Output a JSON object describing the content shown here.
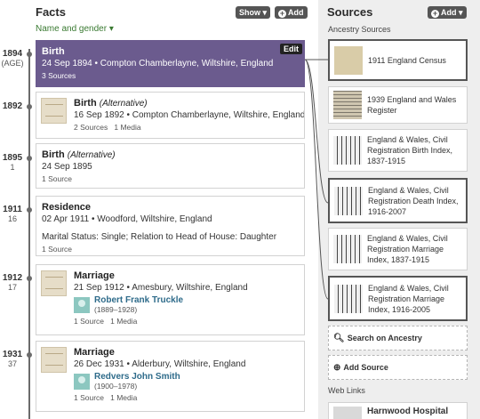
{
  "facts": {
    "title": "Facts",
    "show_label": "Show",
    "add_label": "Add",
    "filter_label": "Name and gender"
  },
  "timeline": [
    {
      "year": "1894",
      "age": "(AGE)"
    },
    {
      "year": "1892",
      "age": ""
    },
    {
      "year": "1895",
      "age": "1"
    },
    {
      "year": "1911",
      "age": "16"
    },
    {
      "year": "1912",
      "age": "17"
    },
    {
      "year": "1931",
      "age": "37"
    }
  ],
  "cards": [
    {
      "title": "Birth",
      "alt": "",
      "detail": "24 Sep 1894 • Compton Chamberlayne, Wiltshire, England",
      "detail2": "",
      "meta": "3 Sources",
      "edit_label": "Edit"
    },
    {
      "title": "Birth",
      "alt": "(Alternative)",
      "detail": "16 Sep 1892 • Compton Chamberlayne, Wiltshire, England",
      "detail2": "",
      "meta": "2 Sources   1 Media"
    },
    {
      "title": "Birth",
      "alt": "(Alternative)",
      "detail": "24 Sep 1895",
      "detail2": "",
      "meta": "1 Source"
    },
    {
      "title": "Residence",
      "alt": "",
      "detail": "02 Apr 1911 • Woodford, Wiltshire, England",
      "detail2": "Marital Status: Single; Relation to Head of House: Daughter",
      "meta": "1 Source"
    },
    {
      "title": "Marriage",
      "alt": "",
      "detail": "21 Sep 1912 • Amesbury, Wiltshire, England",
      "person": "Robert Frank Truckle",
      "years": "(1889–1928)",
      "meta": "1 Source   1 Media"
    },
    {
      "title": "Marriage",
      "alt": "",
      "detail": "26 Dec 1931 • Alderbury, Wiltshire, England",
      "person": "Redvers John Smith",
      "years": "(1900–1978)",
      "meta": "1 Source   1 Media"
    }
  ],
  "sources": {
    "title": "Sources",
    "add_label": "Add",
    "ancestry_label": "Ancestry Sources",
    "items": [
      {
        "text": "1911 England Census"
      },
      {
        "text": "1939 England and Wales Register"
      },
      {
        "text": "England & Wales, Civil Registration Birth Index, 1837-1915"
      },
      {
        "text": "England & Wales, Civil Registration Death Index, 1916-2007"
      },
      {
        "text": "England & Wales, Civil Registration Marriage Index, 1837-1915"
      },
      {
        "text": "England & Wales, Civil Registration Marriage Index, 1916-2005"
      }
    ],
    "search_label": "Search on Ancestry",
    "add_source_label": "Add Source",
    "weblinks_label": "Web Links",
    "weblink_text": "Harnwood Hospital"
  }
}
